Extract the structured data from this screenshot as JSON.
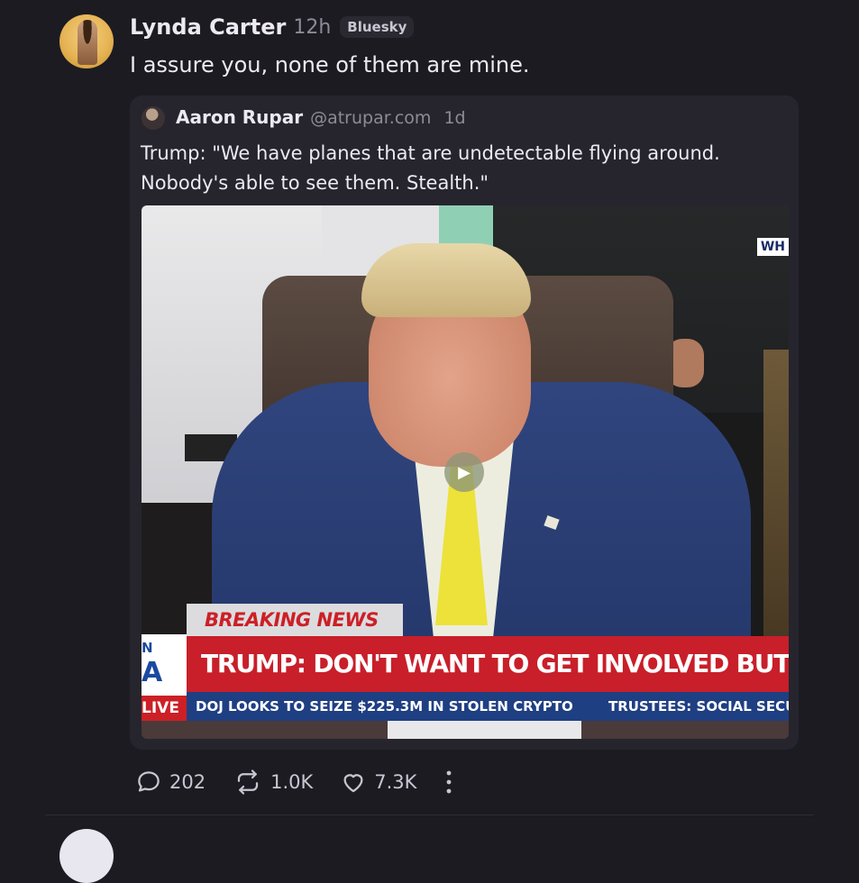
{
  "post": {
    "author": "Lynda Carter",
    "time": "12h",
    "platform_badge": "Bluesky",
    "text": "I assure you, none of them are mine."
  },
  "quote": {
    "author": "Aaron Rupar",
    "handle": "@atrupar.com",
    "time": "1d",
    "text": "Trump: \"We have planes that are undetectable flying around. Nobody's able to see them. Stealth.\""
  },
  "video": {
    "corner_logo": "WH",
    "breaking": "BREAKING NEWS",
    "network_top": "N",
    "network_mid": "A",
    "live": "LIVE",
    "headline": "TRUMP: DON'T WANT TO GET INVOLVED BUT IRAN CAN'T HAVE",
    "ticker_left": "DOJ LOOKS TO SEIZE $225.3M IN STOLEN CRYPTO",
    "ticker_right": "TRUSTEES: SOCIAL SECU"
  },
  "actions": {
    "replies": "202",
    "reposts": "1.0K",
    "likes": "7.3K"
  },
  "icons": {
    "reply": "speech-bubble-icon",
    "repost": "repost-arrows-icon",
    "like": "heart-icon",
    "more": "vertical-ellipsis-icon",
    "play": "play-icon"
  },
  "colors": {
    "background": "#1c1b22",
    "card": "#26252d",
    "breaking_red": "#c81f2a",
    "ticker_blue": "#1f3f83"
  }
}
